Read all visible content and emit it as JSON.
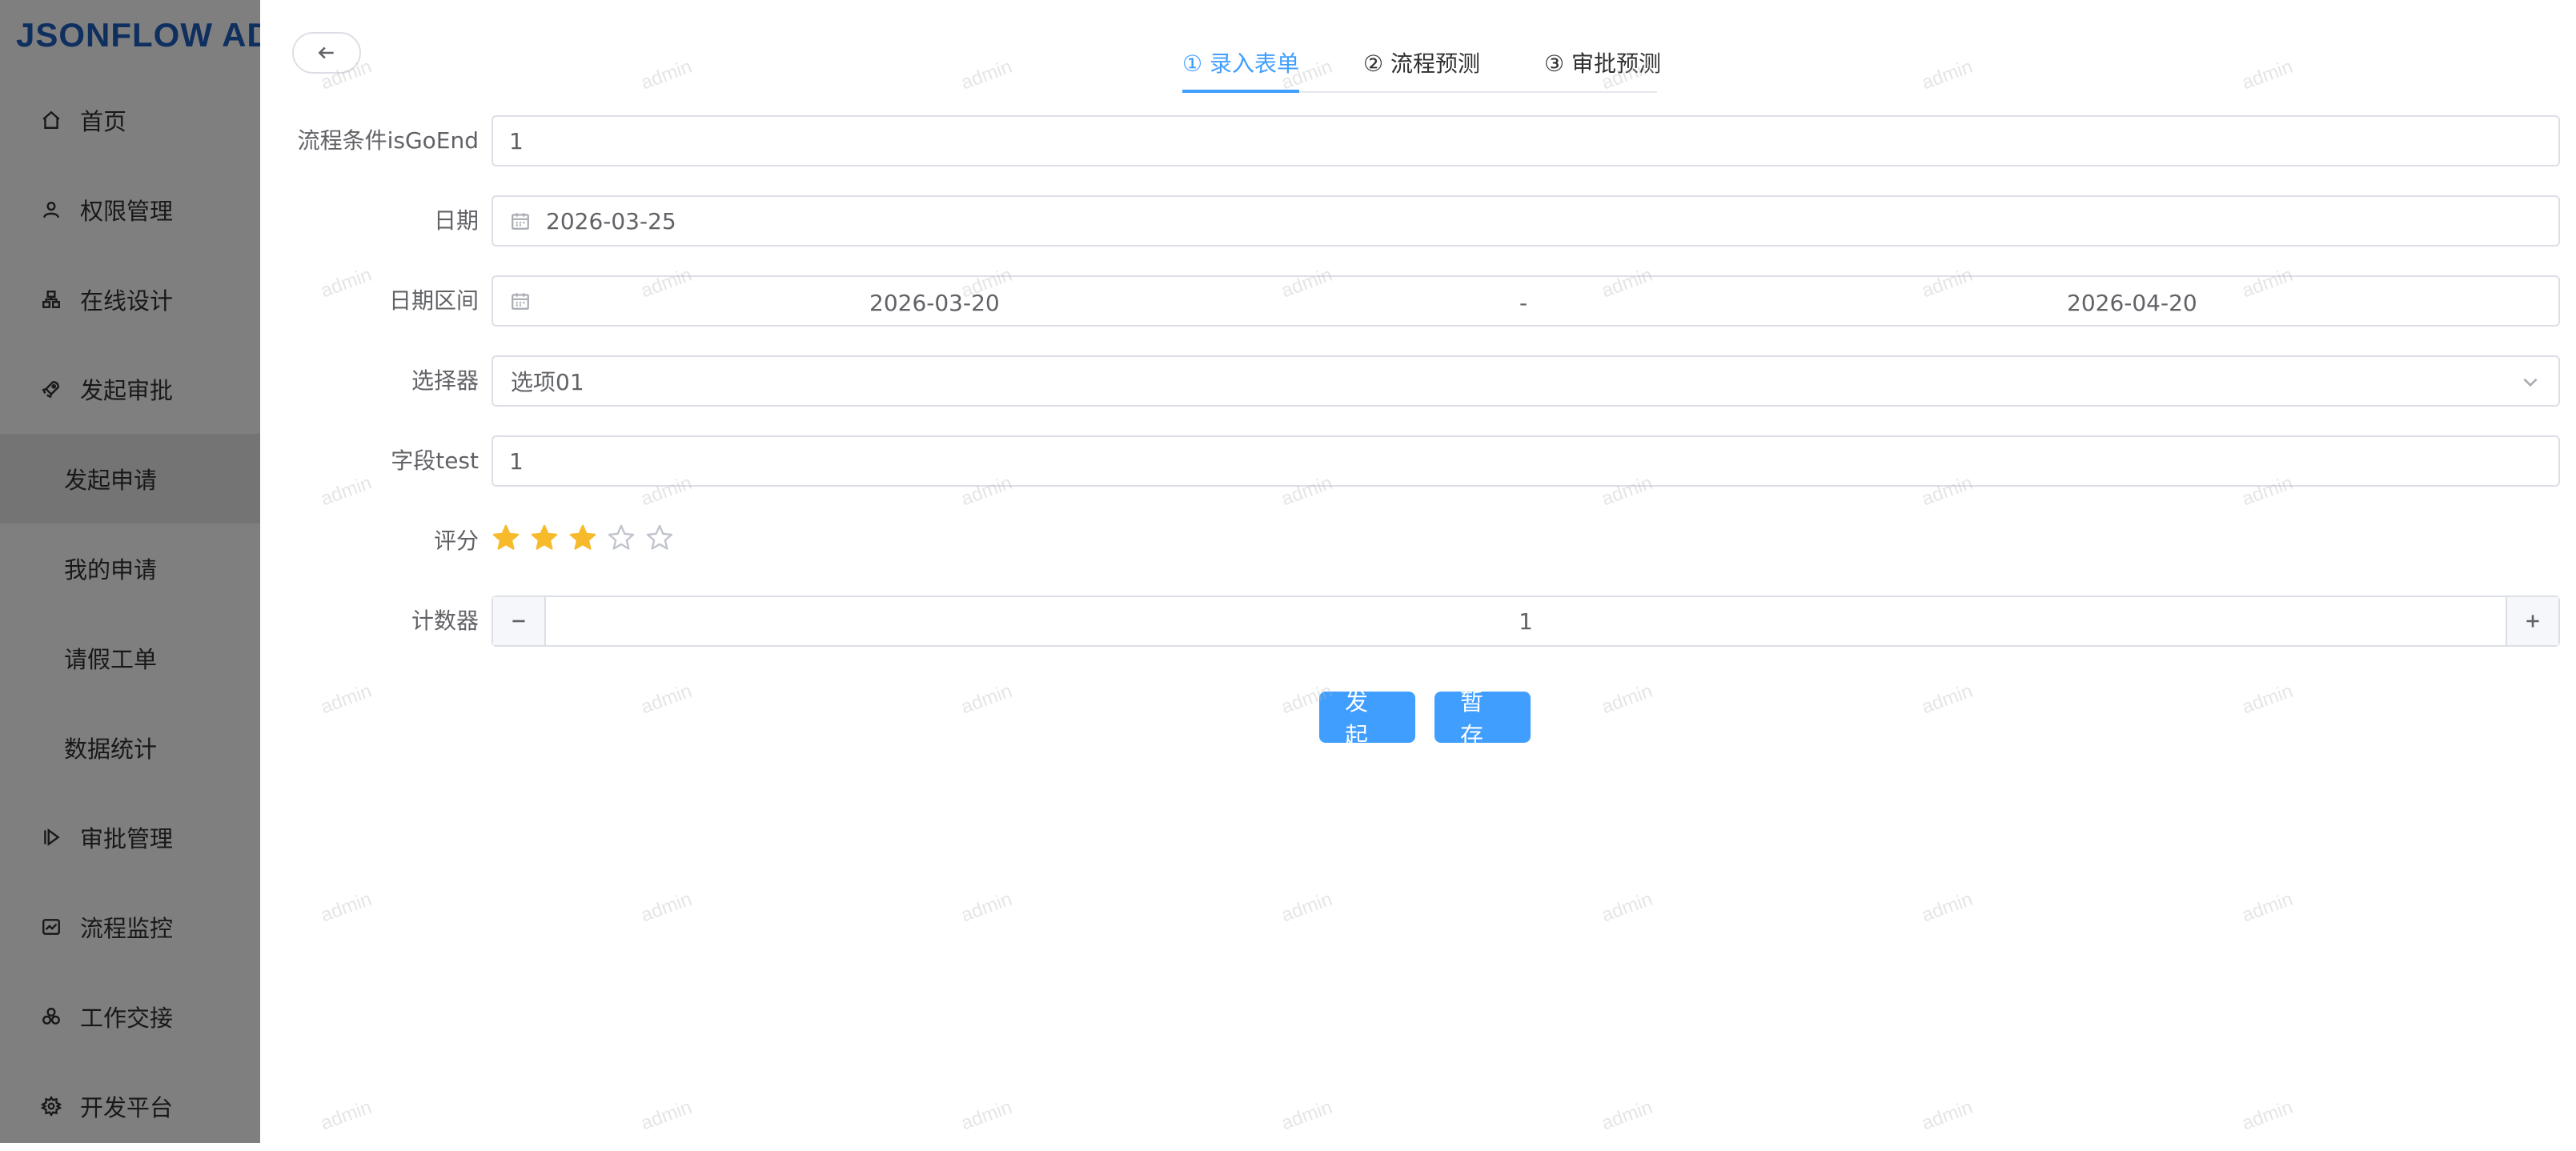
{
  "sidebar": {
    "logo": "JSONFLOW AD",
    "items": [
      {
        "label": "首页",
        "icon": "home-icon"
      },
      {
        "label": "权限管理",
        "icon": "user-icon"
      },
      {
        "label": "在线设计",
        "icon": "design-icon"
      },
      {
        "label": "发起审批",
        "icon": "rocket-icon"
      },
      {
        "label": "发起申请",
        "icon": ""
      },
      {
        "label": "我的申请",
        "icon": ""
      },
      {
        "label": "请假工单",
        "icon": ""
      },
      {
        "label": "数据统计",
        "icon": ""
      },
      {
        "label": "审批管理",
        "icon": "play-icon"
      },
      {
        "label": "流程监控",
        "icon": "monitor-icon"
      },
      {
        "label": "工作交接",
        "icon": "handover-icon"
      },
      {
        "label": "开发平台",
        "icon": "gear-icon"
      }
    ],
    "active_item": "发起申请"
  },
  "tabs": [
    {
      "label": "① 录入表单",
      "active": true
    },
    {
      "label": "② 流程预测",
      "active": false
    },
    {
      "label": "③ 审批预测",
      "active": false
    }
  ],
  "form": {
    "isGoEnd": {
      "label": "流程条件isGoEnd",
      "value": "1"
    },
    "date": {
      "label": "日期",
      "value": "2026-03-25"
    },
    "date_range": {
      "label": "日期区间",
      "start": "2026-03-20",
      "separator": "-",
      "end": "2026-04-20"
    },
    "select": {
      "label": "选择器",
      "value": "选项01"
    },
    "field_test": {
      "label": "字段test",
      "value": "1"
    },
    "rating": {
      "label": "评分",
      "value": 3,
      "max": 5
    },
    "counter": {
      "label": "计数器",
      "value": "1"
    }
  },
  "actions": {
    "submit_label": "发起",
    "save_label": "暂存"
  },
  "watermark": "admin",
  "colors": {
    "primary": "#409eff",
    "star": "#f7ba2a",
    "logo": "#1f5fbf"
  }
}
